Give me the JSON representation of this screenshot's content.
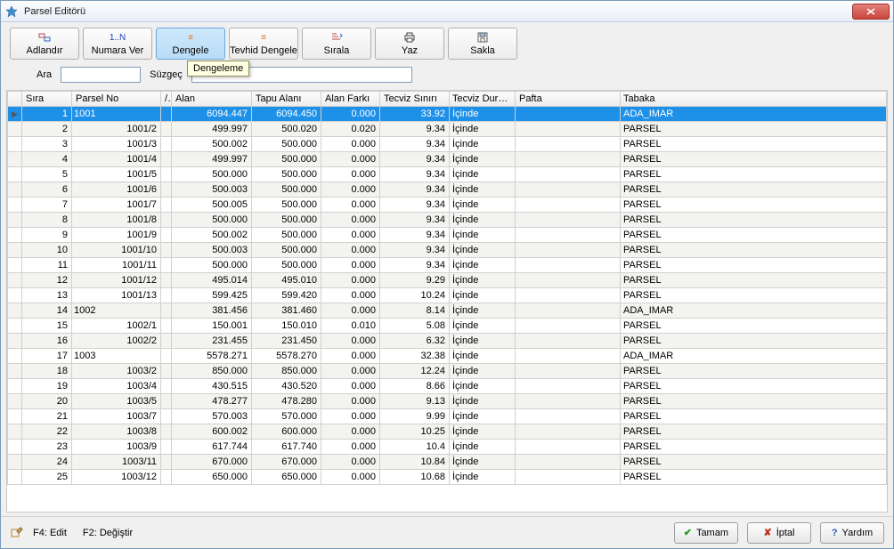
{
  "window": {
    "title": "Parsel Editörü"
  },
  "toolbar": {
    "adlandir": "Adlandır",
    "numaraver": "Numara Ver",
    "numaraver_icon_text": "1..N",
    "dengele": "Dengele",
    "tevhid": "Tevhid Dengele",
    "sirala": "Sırala",
    "yaz": "Yaz",
    "sakla": "Sakla",
    "tooltip": "Dengeleme"
  },
  "filter": {
    "ara_label": "Ara",
    "suzgec_label": "Süzgeç",
    "ara_value": "",
    "suzgec_value": "*"
  },
  "columns": {
    "sira": "Sıra",
    "parsel": "Parsel No",
    "slash": "/",
    "alan": "Alan",
    "tapu": "Tapu Alanı",
    "fark": "Alan Farkı",
    "tecviz": "Tecviz Sınırı",
    "durum": "Tecviz Durum",
    "pafta": "Pafta",
    "tabaka": "Tabaka"
  },
  "rows": [
    {
      "sira": "1",
      "parsel": "1001",
      "alan": "6094.447",
      "tapu": "6094.450",
      "fark": "0.000",
      "tecviz": "33.92",
      "durum": "İçinde",
      "pafta": "",
      "tabaka": "ADA_IMAR",
      "selected": true
    },
    {
      "sira": "2",
      "parsel": "1001/2",
      "alan": "499.997",
      "tapu": "500.020",
      "fark": "0.020",
      "tecviz": "9.34",
      "durum": "İçinde",
      "pafta": "",
      "tabaka": "PARSEL"
    },
    {
      "sira": "3",
      "parsel": "1001/3",
      "alan": "500.002",
      "tapu": "500.000",
      "fark": "0.000",
      "tecviz": "9.34",
      "durum": "İçinde",
      "pafta": "",
      "tabaka": "PARSEL"
    },
    {
      "sira": "4",
      "parsel": "1001/4",
      "alan": "499.997",
      "tapu": "500.000",
      "fark": "0.000",
      "tecviz": "9.34",
      "durum": "İçinde",
      "pafta": "",
      "tabaka": "PARSEL"
    },
    {
      "sira": "5",
      "parsel": "1001/5",
      "alan": "500.000",
      "tapu": "500.000",
      "fark": "0.000",
      "tecviz": "9.34",
      "durum": "İçinde",
      "pafta": "",
      "tabaka": "PARSEL"
    },
    {
      "sira": "6",
      "parsel": "1001/6",
      "alan": "500.003",
      "tapu": "500.000",
      "fark": "0.000",
      "tecviz": "9.34",
      "durum": "İçinde",
      "pafta": "",
      "tabaka": "PARSEL"
    },
    {
      "sira": "7",
      "parsel": "1001/7",
      "alan": "500.005",
      "tapu": "500.000",
      "fark": "0.000",
      "tecviz": "9.34",
      "durum": "İçinde",
      "pafta": "",
      "tabaka": "PARSEL"
    },
    {
      "sira": "8",
      "parsel": "1001/8",
      "alan": "500.000",
      "tapu": "500.000",
      "fark": "0.000",
      "tecviz": "9.34",
      "durum": "İçinde",
      "pafta": "",
      "tabaka": "PARSEL"
    },
    {
      "sira": "9",
      "parsel": "1001/9",
      "alan": "500.002",
      "tapu": "500.000",
      "fark": "0.000",
      "tecviz": "9.34",
      "durum": "İçinde",
      "pafta": "",
      "tabaka": "PARSEL"
    },
    {
      "sira": "10",
      "parsel": "1001/10",
      "alan": "500.003",
      "tapu": "500.000",
      "fark": "0.000",
      "tecviz": "9.34",
      "durum": "İçinde",
      "pafta": "",
      "tabaka": "PARSEL"
    },
    {
      "sira": "11",
      "parsel": "1001/11",
      "alan": "500.000",
      "tapu": "500.000",
      "fark": "0.000",
      "tecviz": "9.34",
      "durum": "İçinde",
      "pafta": "",
      "tabaka": "PARSEL"
    },
    {
      "sira": "12",
      "parsel": "1001/12",
      "alan": "495.014",
      "tapu": "495.010",
      "fark": "0.000",
      "tecviz": "9.29",
      "durum": "İçinde",
      "pafta": "",
      "tabaka": "PARSEL"
    },
    {
      "sira": "13",
      "parsel": "1001/13",
      "alan": "599.425",
      "tapu": "599.420",
      "fark": "0.000",
      "tecviz": "10.24",
      "durum": "İçinde",
      "pafta": "",
      "tabaka": "PARSEL"
    },
    {
      "sira": "14",
      "parsel": "1002",
      "alan": "381.456",
      "tapu": "381.460",
      "fark": "0.000",
      "tecviz": "8.14",
      "durum": "İçinde",
      "pafta": "",
      "tabaka": "ADA_IMAR",
      "leftAlign": true
    },
    {
      "sira": "15",
      "parsel": "1002/1",
      "alan": "150.001",
      "tapu": "150.010",
      "fark": "0.010",
      "tecviz": "5.08",
      "durum": "İçinde",
      "pafta": "",
      "tabaka": "PARSEL"
    },
    {
      "sira": "16",
      "parsel": "1002/2",
      "alan": "231.455",
      "tapu": "231.450",
      "fark": "0.000",
      "tecviz": "6.32",
      "durum": "İçinde",
      "pafta": "",
      "tabaka": "PARSEL"
    },
    {
      "sira": "17",
      "parsel": "1003",
      "alan": "5578.271",
      "tapu": "5578.270",
      "fark": "0.000",
      "tecviz": "32.38",
      "durum": "İçinde",
      "pafta": "",
      "tabaka": "ADA_IMAR",
      "leftAlign": true
    },
    {
      "sira": "18",
      "parsel": "1003/2",
      "alan": "850.000",
      "tapu": "850.000",
      "fark": "0.000",
      "tecviz": "12.24",
      "durum": "İçinde",
      "pafta": "",
      "tabaka": "PARSEL"
    },
    {
      "sira": "19",
      "parsel": "1003/4",
      "alan": "430.515",
      "tapu": "430.520",
      "fark": "0.000",
      "tecviz": "8.66",
      "durum": "İçinde",
      "pafta": "",
      "tabaka": "PARSEL"
    },
    {
      "sira": "20",
      "parsel": "1003/5",
      "alan": "478.277",
      "tapu": "478.280",
      "fark": "0.000",
      "tecviz": "9.13",
      "durum": "İçinde",
      "pafta": "",
      "tabaka": "PARSEL"
    },
    {
      "sira": "21",
      "parsel": "1003/7",
      "alan": "570.003",
      "tapu": "570.000",
      "fark": "0.000",
      "tecviz": "9.99",
      "durum": "İçinde",
      "pafta": "",
      "tabaka": "PARSEL"
    },
    {
      "sira": "22",
      "parsel": "1003/8",
      "alan": "600.002",
      "tapu": "600.000",
      "fark": "0.000",
      "tecviz": "10.25",
      "durum": "İçinde",
      "pafta": "",
      "tabaka": "PARSEL"
    },
    {
      "sira": "23",
      "parsel": "1003/9",
      "alan": "617.744",
      "tapu": "617.740",
      "fark": "0.000",
      "tecviz": "10.4",
      "durum": "İçinde",
      "pafta": "",
      "tabaka": "PARSEL"
    },
    {
      "sira": "24",
      "parsel": "1003/11",
      "alan": "670.000",
      "tapu": "670.000",
      "fark": "0.000",
      "tecviz": "10.84",
      "durum": "İçinde",
      "pafta": "",
      "tabaka": "PARSEL"
    },
    {
      "sira": "25",
      "parsel": "1003/12",
      "alan": "650.000",
      "tapu": "650.000",
      "fark": "0.000",
      "tecviz": "10.68",
      "durum": "İçinde",
      "pafta": "",
      "tabaka": "PARSEL"
    }
  ],
  "statusbar": {
    "hint1": "F4: Edit",
    "hint2": "F2: Değiştir"
  },
  "buttons": {
    "ok": "Tamam",
    "cancel": "İptal",
    "help": "Yardım"
  }
}
